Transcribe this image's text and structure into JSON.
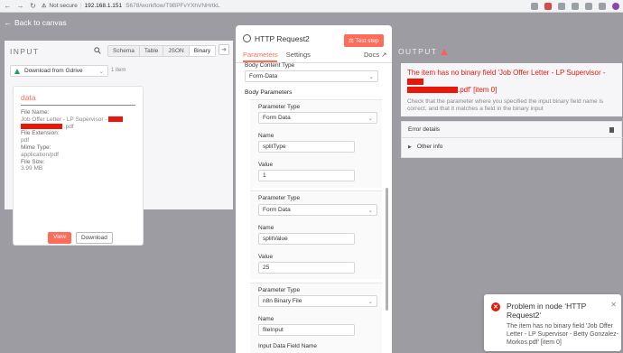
{
  "browser": {
    "security": "Not secure",
    "host": "192.168.1.151",
    "path": ":5678/workflow/T9BPFvYXhVNHrtkL"
  },
  "app": {
    "logo": "n8n",
    "back_label": "Back to canvas"
  },
  "input_panel": {
    "heading": "INPUT",
    "tabs": [
      "Schema",
      "Table",
      "JSON",
      "Binary"
    ],
    "active_tab": "Binary",
    "source_node": "Download from Gdrive",
    "item_count": "1 item",
    "card": {
      "title": "data",
      "file_name_label": "File Name:",
      "file_name_value_1": "Job Offer Letter - LP Supervisor -",
      "file_name_value_2": ".pdf",
      "file_extension_label": "File Extension:",
      "file_extension_value": "pdf",
      "mime_type_label": "Mime Type:",
      "mime_type_value": "application/pdf",
      "file_size_label": "File Size:",
      "file_size_value": "3.99 MB",
      "view_label": "View",
      "download_label": "Download"
    }
  },
  "node": {
    "title": "HTTP Request2",
    "test_step_label": "Test step",
    "tabs": [
      "Parameters",
      "Settings"
    ],
    "active_tab": "Parameters",
    "docs_label": "Docs",
    "body_content_type_label": "Body Content Type",
    "body_content_type_value": "Form-Data",
    "body_parameters_label": "Body Parameters",
    "params": [
      {
        "type_label": "Parameter Type",
        "type_value": "Form Data",
        "name_label": "Name",
        "name_value": "splitType",
        "value_label": "Value",
        "value_value": "1"
      },
      {
        "type_label": "Parameter Type",
        "type_value": "Form Data",
        "name_label": "Name",
        "name_value": "splitValue",
        "value_label": "Value",
        "value_value": "25"
      },
      {
        "type_label": "Parameter Type",
        "type_value": "n8n Binary File",
        "name_label": "Name",
        "name_value": "fileInput",
        "value_label": "Input Data Field Name",
        "value_value": ""
      }
    ]
  },
  "output_panel": {
    "heading": "OUTPUT",
    "error_title_1": "The item has no binary field 'Job Offer Letter - LP Supervisor -",
    "error_title_2": ".pdf' [item 0]",
    "error_desc": "Check that the parameter where you specified the input binary field name is correct, and that it matches a field in the binary input",
    "error_details_label": "Error details",
    "other_info_label": "Other info"
  },
  "toast": {
    "title": "Problem in node ‘HTTP Request2‘",
    "body": "The item has no binary field 'Job Offer Letter - LP Supervisor - Betty Gonzalez-Morkos.pdf' [item 0]"
  },
  "colors": {
    "accent": "#ff6d5a",
    "error": "#e8170a"
  }
}
